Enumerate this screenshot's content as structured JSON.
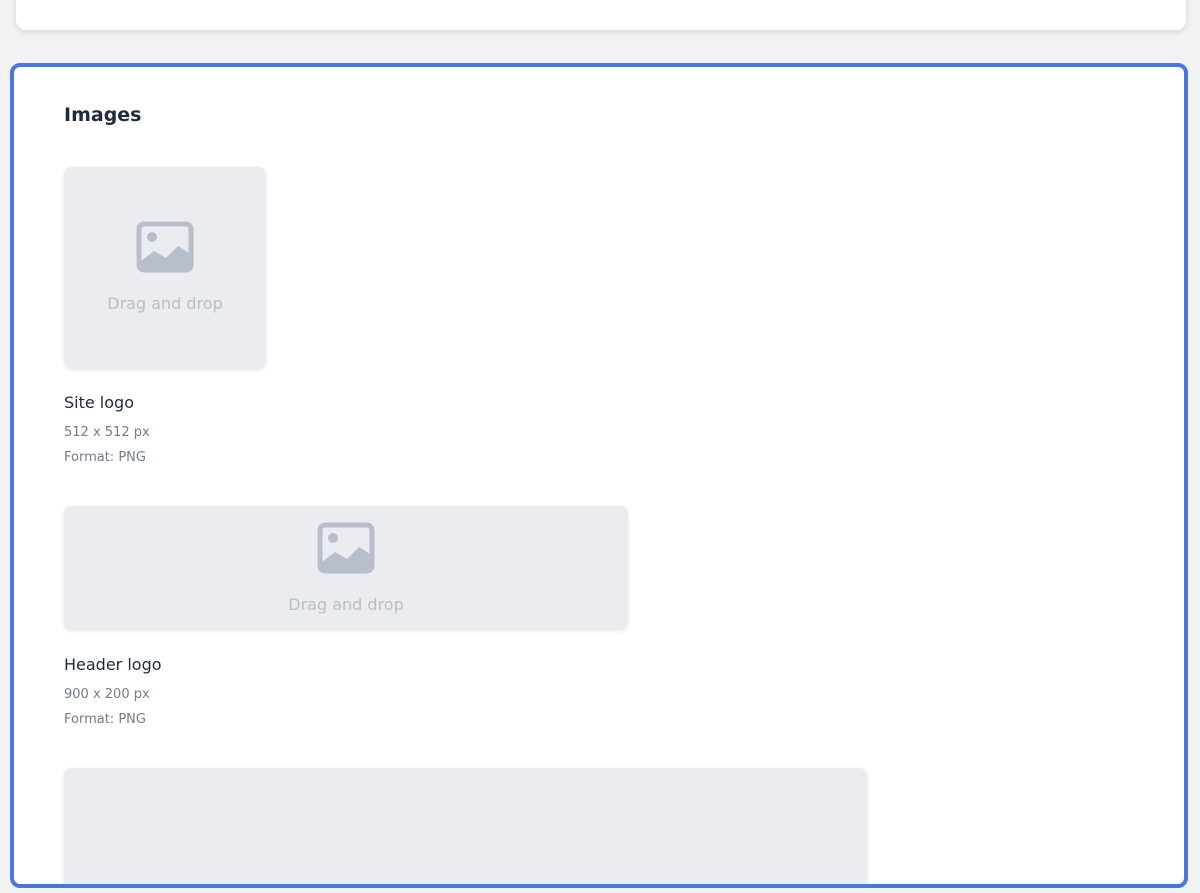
{
  "section": {
    "title": "Images"
  },
  "uploads": [
    {
      "drop_text": "Drag and drop",
      "label": "Site logo",
      "size": "512 x 512 px",
      "format": "Format: PNG"
    },
    {
      "drop_text": "Drag and drop",
      "label": "Header logo",
      "size": "900 x 200 px",
      "format": "Format: PNG"
    }
  ],
  "icons": {
    "placeholder": "image-placeholder-icon"
  },
  "colors": {
    "accent": "#4a76de",
    "placeholder": "#b8becb",
    "dropzone": "#ebecf0"
  }
}
